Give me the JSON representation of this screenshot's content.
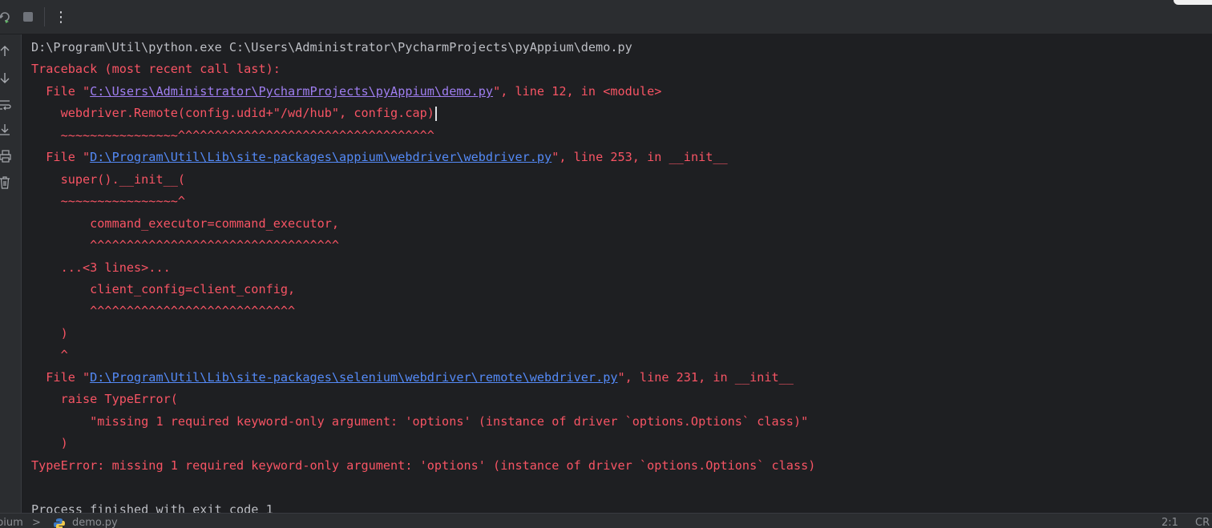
{
  "toolbar": {
    "rerun_icon": "rerun-icon",
    "stop_icon": "stop-icon",
    "more_icon": "more-vertical-icon",
    "more_glyph": "⋮"
  },
  "gutter": {
    "icons": [
      "arrow-up-icon",
      "arrow-down-icon",
      "soft-wrap-icon",
      "scroll-to-end-icon",
      "print-icon",
      "trash-icon"
    ]
  },
  "console": {
    "command": "D:\\Program\\Util\\python.exe C:\\Users\\Administrator\\PycharmProjects\\pyAppium\\demo.py",
    "traceback_header": "Traceback (most recent call last):",
    "frame1": {
      "prefix": "  File \"",
      "path": "C:\\Users\\Administrator\\PycharmProjects\\pyAppium\\demo.py",
      "suffix": "\", line 12, in <module>"
    },
    "frame1_code": "    webdriver.Remote(config.udid+\"/wd/hub\", config.cap)",
    "frame1_marker": "    ~~~~~~~~~~~~~~~~^^^^^^^^^^^^^^^^^^^^^^^^^^^^^^^^^^^",
    "frame2": {
      "prefix": "  File \"",
      "path": "D:\\Program\\Util\\Lib\\site-packages\\appium\\webdriver\\webdriver.py",
      "suffix": "\", line 253, in __init__"
    },
    "frame2_code": "    super().__init__(",
    "frame2_marker": "    ~~~~~~~~~~~~~~~~^",
    "frame2_arg1": "        command_executor=command_executor,",
    "frame2_arg1_marker": "        ^^^^^^^^^^^^^^^^^^^^^^^^^^^^^^^^^^",
    "frame2_elided": "    ...<3 lines>...",
    "frame2_arg2": "        client_config=client_config,",
    "frame2_arg2_marker": "        ^^^^^^^^^^^^^^^^^^^^^^^^^^^^",
    "frame2_close": "    )",
    "frame2_close_marker": "    ^",
    "frame3": {
      "prefix": "  File \"",
      "path": "D:\\Program\\Util\\Lib\\site-packages\\selenium\\webdriver\\remote\\webdriver.py",
      "suffix": "\", line 231, in __init__"
    },
    "frame3_code": "    raise TypeError(",
    "frame3_msg": "        \"missing 1 required keyword-only argument: 'options' (instance of driver `options.Options` class)\"",
    "frame3_close": "    )",
    "error_line": "TypeError: missing 1 required keyword-only argument: 'options' (instance of driver `options.Options` class)",
    "exit_line": "Process finished with exit code 1"
  },
  "statusbar": {
    "project_crumb": "pium",
    "chevron": ">",
    "file_crumb": "demo.py",
    "cursor_pos": "2:1",
    "line_sep": "CR"
  }
}
